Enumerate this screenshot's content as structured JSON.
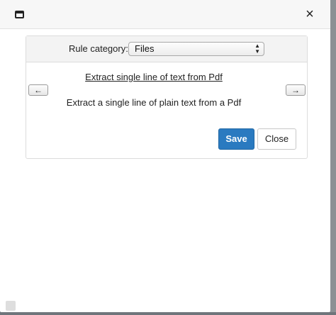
{
  "dialog": {
    "close_glyph": "×"
  },
  "rule_category": {
    "label": "Rule category:",
    "selected": "Files",
    "options": [
      "Files"
    ]
  },
  "rule": {
    "title": "Extract single line of text from Pdf",
    "description": "Extract a single line of plain text from a Pdf"
  },
  "nav": {
    "prev_glyph": "🡐",
    "next_glyph": "🡒"
  },
  "buttons": {
    "save_label": "Save",
    "close_label": "Close"
  },
  "colors": {
    "primary": "#2a7ac0",
    "backdrop": "#6f757b"
  }
}
